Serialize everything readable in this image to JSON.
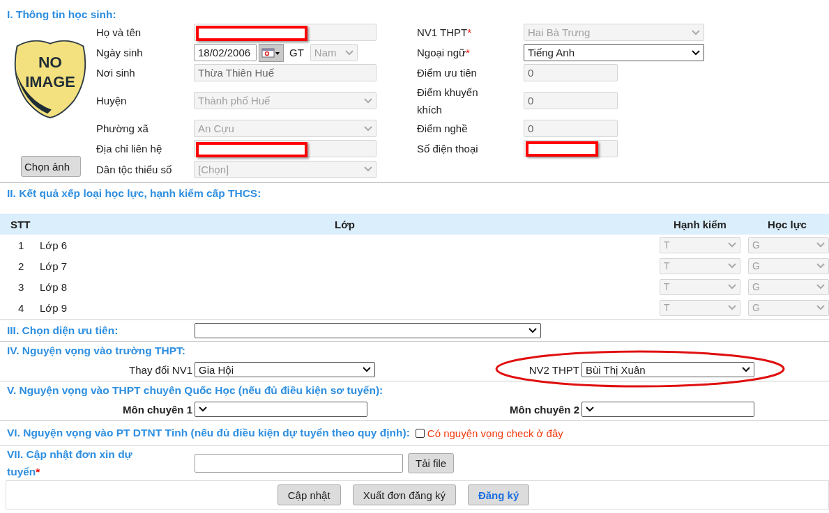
{
  "section_1": {
    "title": "I. Thông tin học sinh:",
    "photo": {
      "lines": [
        "NO",
        "IMAGE"
      ]
    },
    "photo_button": "Chọn ảnh",
    "rows": [
      {
        "left": {
          "label": "Họ và tên",
          "kind": "text",
          "disabled": true,
          "redacted": true
        },
        "right": {
          "label": "NV1 THPT",
          "required_mark": "*",
          "kind": "select",
          "value": "Hai Bà Trưng",
          "disabled": true
        }
      },
      {
        "left": {
          "label": "Ngày sinh",
          "kind": "date",
          "value": "18/02/2006",
          "gender_label": "GT",
          "gender_value": "Nam",
          "disabled": false
        },
        "right": {
          "label": "Ngoại ngữ",
          "required_mark": "*",
          "kind": "select",
          "value": "Tiếng Anh",
          "disabled": false
        }
      },
      {
        "left": {
          "label": "Nơi sinh",
          "kind": "text",
          "value": "Thừa Thiên Huế",
          "disabled": true
        },
        "right": {
          "label": "Điểm ưu tiên",
          "kind": "short",
          "value": "0",
          "disabled": true
        }
      },
      {
        "left": {
          "label": "Huyện",
          "kind": "select",
          "value": "Thành phố Huế",
          "disabled": true
        },
        "right": {
          "label": "Điểm khuyến khích",
          "kind": "short",
          "value": "0",
          "disabled": true
        }
      },
      {
        "left": {
          "label": "Phường xã",
          "kind": "select",
          "value": "An Cựu",
          "disabled": true
        },
        "right": {
          "label": "Điểm nghề",
          "kind": "short",
          "value": "0",
          "disabled": true
        }
      },
      {
        "left": {
          "label": "Địa chỉ liên hệ",
          "kind": "text",
          "disabled": true,
          "redacted": true
        },
        "right": {
          "label": "Số điện thoại",
          "kind": "short",
          "disabled": true,
          "redacted": true
        }
      },
      {
        "left": {
          "label": "Dân tộc thiểu số",
          "kind": "select",
          "value": "[Chọn]",
          "disabled": true
        }
      }
    ]
  },
  "section_2": {
    "title": "II. Kết quả xếp loại học lực, hạnh kiểm cấp THCS:",
    "columns": [
      "STT",
      "Lớp",
      "Hạnh kiểm",
      "Học lực"
    ],
    "rows": [
      {
        "stt": "1",
        "name": "Lớp 6",
        "conduct": "T",
        "academic": "G"
      },
      {
        "stt": "2",
        "name": "Lớp 7",
        "conduct": "T",
        "academic": "G"
      },
      {
        "stt": "3",
        "name": "Lớp 8",
        "conduct": "T",
        "academic": "G"
      },
      {
        "stt": "4",
        "name": "Lớp 9",
        "conduct": "T",
        "academic": "G"
      }
    ]
  },
  "section_3": {
    "title": "III. Chọn diện ưu tiên:"
  },
  "section_4": {
    "title": "IV. Nguyện vọng vào trường THPT:",
    "nv1_label": "Thay đổi NV1",
    "nv1_value": "Gia Hội",
    "nv2_label": "NV2 THPT",
    "nv2_value": "Bùi Thị Xuân",
    "nv2_highlighted": true
  },
  "section_5": {
    "title": "V. Nguyện vọng vào THPT chuyên Quốc Học (nếu đủ điều kiện sơ tuyển):",
    "subject_1_label": "Môn chuyên 1",
    "subject_2_label": "Môn chuyên 2"
  },
  "section_6": {
    "title": "VI. Nguyện vọng vào PT DTNT Tỉnh (nếu đủ điều kiện dự tuyển theo quy định):",
    "checked": false,
    "check_label": "Có nguyện vọng check ở đây"
  },
  "section_7": {
    "title": "VII. Cập nhật đơn xin dự tuyển",
    "required_mark": "*",
    "upload_button": "Tải file"
  },
  "buttons": [
    {
      "label": "Cập nhật",
      "primary": false
    },
    {
      "label": "Xuất đơn đăng ký",
      "primary": false
    },
    {
      "label": "Đăng ký",
      "primary": true
    }
  ]
}
